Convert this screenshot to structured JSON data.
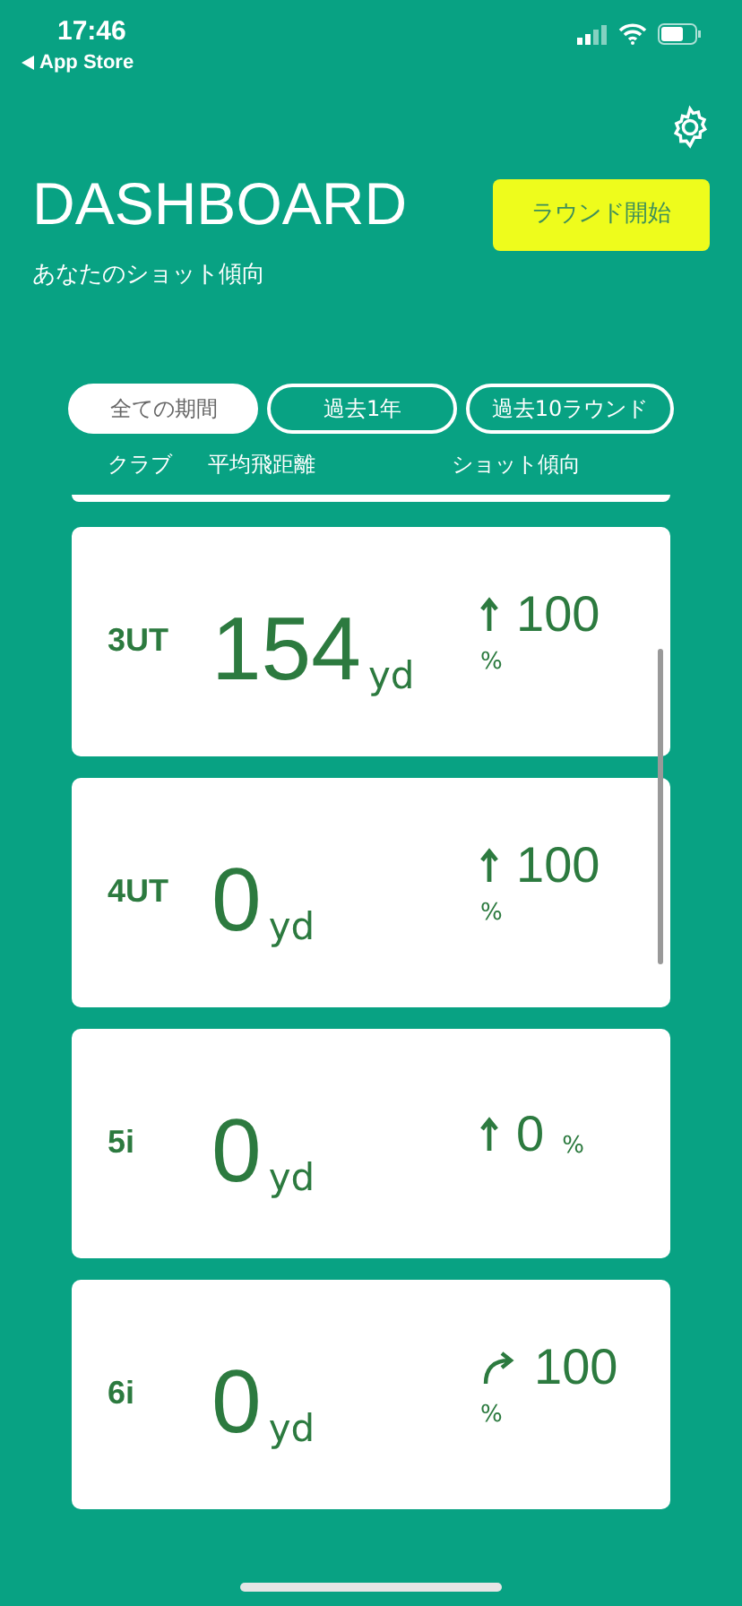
{
  "status_bar": {
    "time": "17:46",
    "back_label": "App Store"
  },
  "header": {
    "title": "DASHBOARD",
    "subtitle": "あなたのショット傾向",
    "start_button": "ラウンド開始"
  },
  "period_tabs": [
    {
      "label": "全ての期間",
      "selected": true
    },
    {
      "label": "過去1年",
      "selected": false
    },
    {
      "label": "過去10ラウンド",
      "selected": false
    }
  ],
  "columns": [
    "クラブ",
    "平均飛距離",
    "ショット傾向"
  ],
  "clubs": [
    {
      "club": "3UT",
      "distance": "154",
      "unit": "yd",
      "kind": "straight",
      "trend": "100",
      "percent": "%"
    },
    {
      "club": "4UT",
      "distance": "0",
      "unit": "yd",
      "kind": "straight",
      "trend": "100",
      "percent": "%"
    },
    {
      "club": "5i",
      "distance": "0",
      "unit": "yd",
      "kind": "straight",
      "trend": "0",
      "percent": "%"
    },
    {
      "club": "6i",
      "distance": "0",
      "unit": "yd",
      "kind": "curve",
      "trend": "100",
      "percent": "%"
    }
  ]
}
